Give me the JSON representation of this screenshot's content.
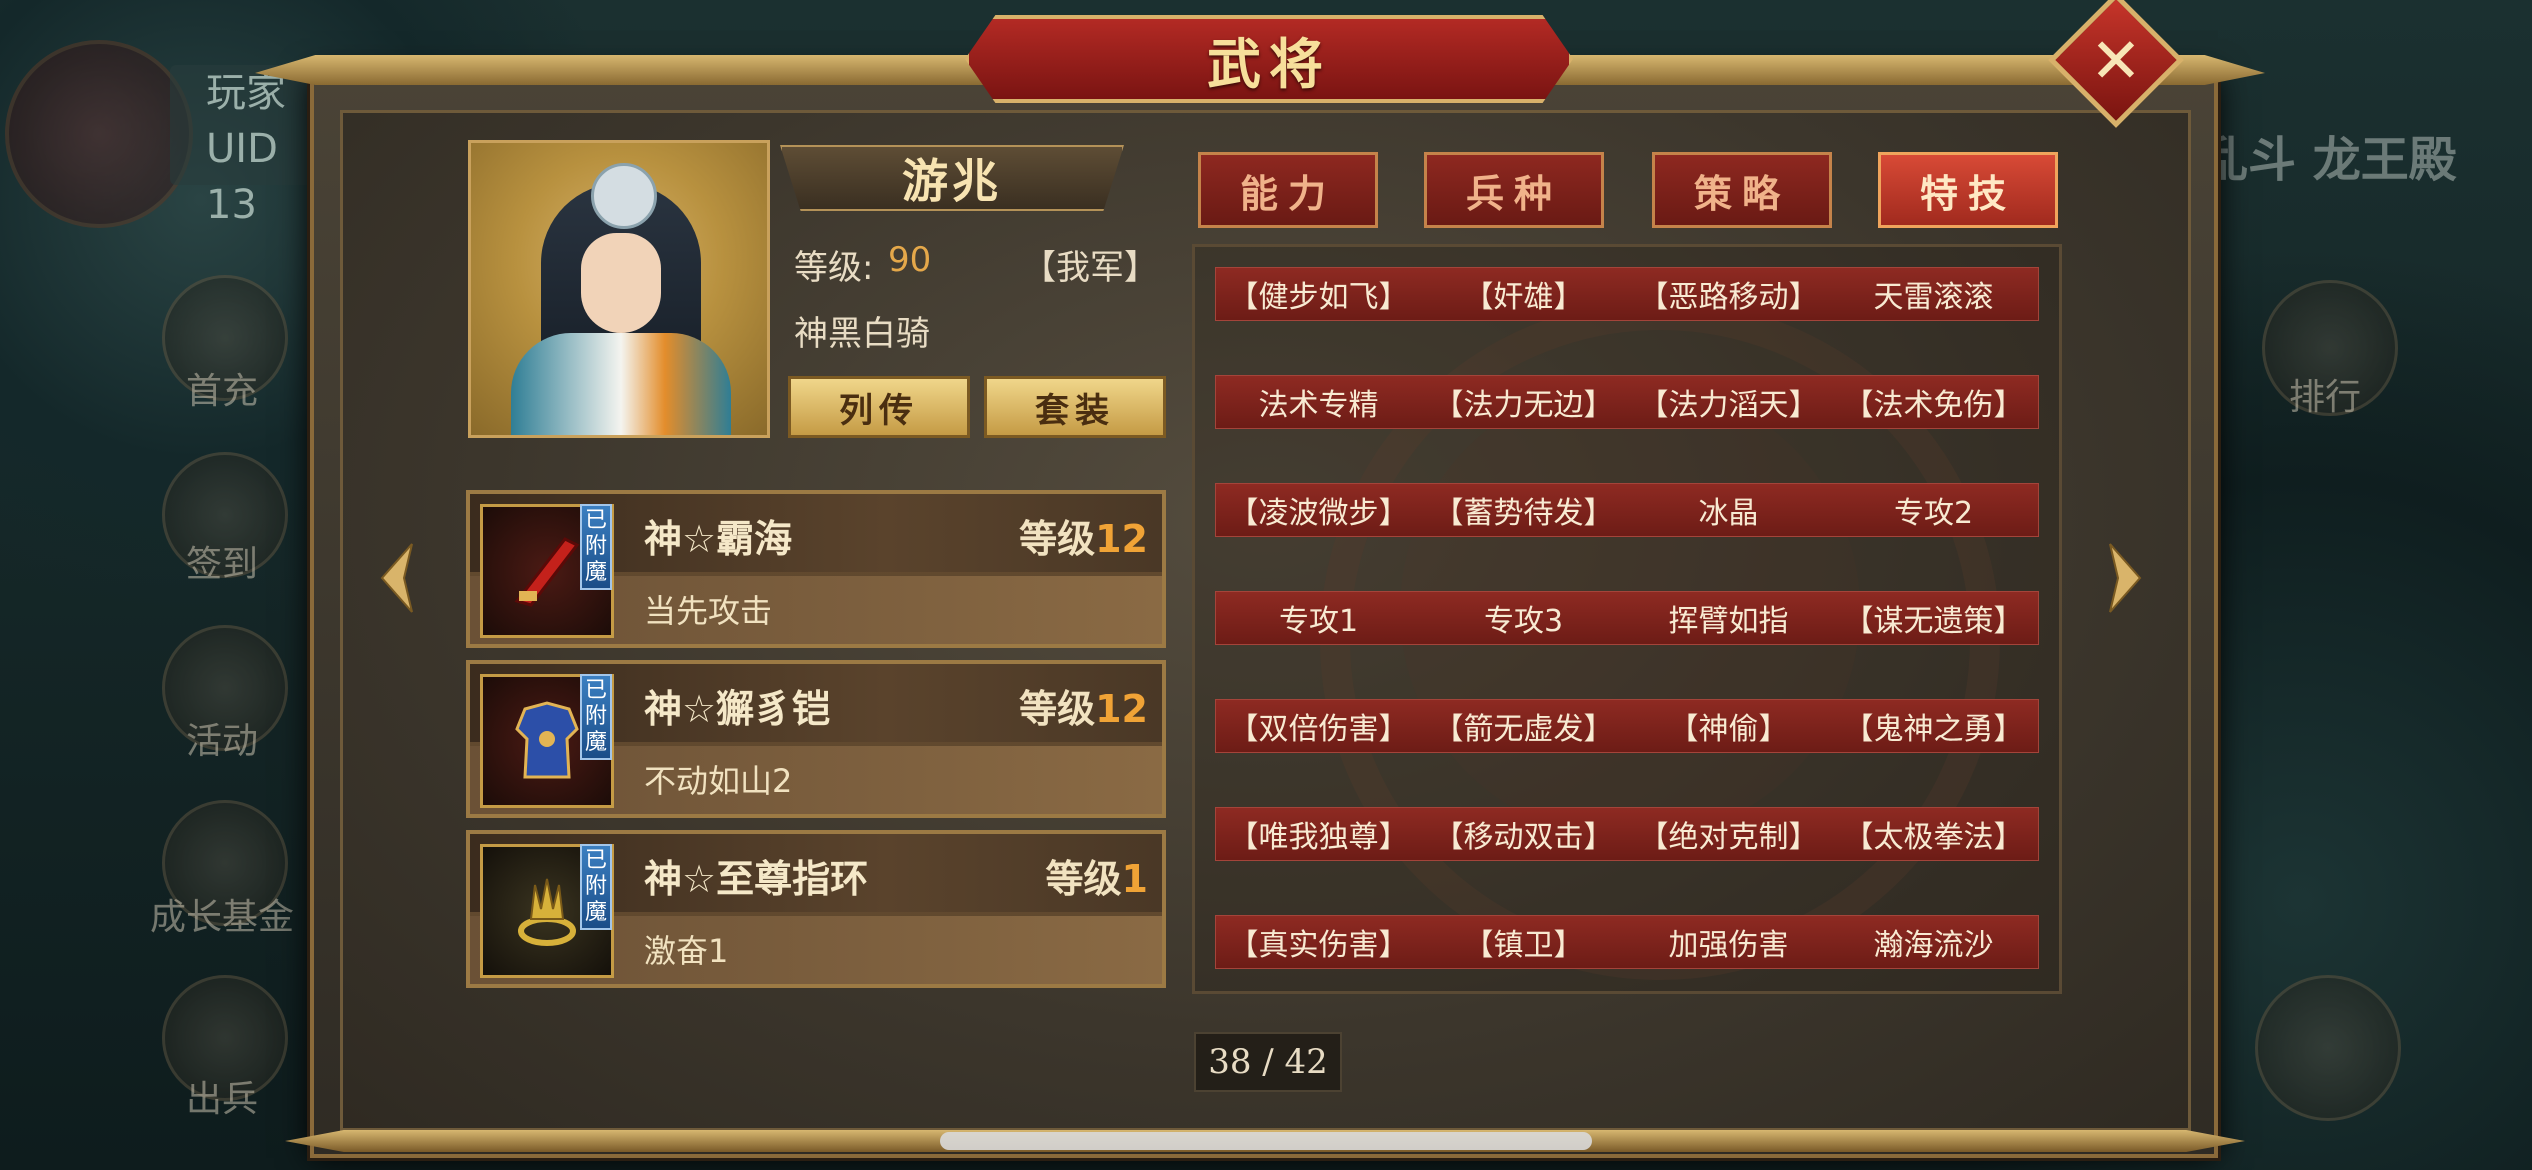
{
  "header": {
    "title": "武将"
  },
  "hud": {
    "player_label": "玩家",
    "uid_label": "UID 13",
    "right_title": "乱斗 龙王殿",
    "left_buttons": [
      "首充",
      "签到",
      "活动",
      "成长基金",
      "出兵"
    ],
    "right_buttons": [
      "排行"
    ]
  },
  "hero": {
    "name": "游兆",
    "level_label": "等级:",
    "level_value": "90",
    "faction": "【我军】",
    "unit_class": "神黑白骑",
    "biography_button": "列传",
    "set_button": "套装"
  },
  "equipment": [
    {
      "name": "神☆霸海",
      "level_label": "等级",
      "level": "12",
      "skill": "当先攻击",
      "badge": "已附魔",
      "icon": "blade-icon",
      "color": "#c4211b"
    },
    {
      "name": "神☆獬豸铠",
      "level_label": "等级",
      "level": "12",
      "skill": "不动如山2",
      "badge": "已附魔",
      "icon": "armor-icon",
      "color": "#2c4fa8"
    },
    {
      "name": "神☆至尊指环",
      "level_label": "等级",
      "level": "1",
      "skill": "激奋1",
      "badge": "已附魔",
      "icon": "ring-icon",
      "color": "#d7b13a"
    }
  ],
  "tabs": [
    {
      "label": "能力",
      "active": false
    },
    {
      "label": "兵种",
      "active": false
    },
    {
      "label": "策略",
      "active": false
    },
    {
      "label": "特技",
      "active": true
    }
  ],
  "skills": [
    [
      "【健步如飞】",
      "【奸雄】",
      "【恶路移动】",
      "天雷滚滚"
    ],
    [
      "法术专精",
      "【法力无边】",
      "【法力滔天】",
      "【法术免伤】"
    ],
    [
      "【凌波微步】",
      "【蓄势待发】",
      "冰晶",
      "专攻2"
    ],
    [
      "专攻1",
      "专攻3",
      "挥臂如指",
      "【谋无遗策】"
    ],
    [
      "【双倍伤害】",
      "【箭无虚发】",
      "【神偷】",
      "【鬼神之勇】"
    ],
    [
      "【唯我独尊】",
      "【移动双击】",
      "【绝对克制】",
      "【太极拳法】"
    ],
    [
      "【真实伤害】",
      "【镇卫】",
      "加强伤害",
      "瀚海流沙"
    ]
  ],
  "pagination": {
    "text": "38 / 42"
  },
  "colors": {
    "accent_red": "#8e2a22",
    "gold": "#d8b16a",
    "level_orange": "#f0a336"
  }
}
